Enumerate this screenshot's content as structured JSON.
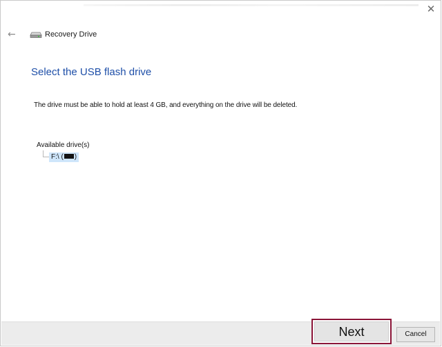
{
  "window": {
    "close_glyph": "✕",
    "back_glyph": "←"
  },
  "header": {
    "app_title": "Recovery Drive",
    "icon": "drive-icon"
  },
  "main": {
    "page_title": "Select the USB flash drive",
    "description": "The drive must be able to hold at least 4 GB, and everything on the drive will be deleted.",
    "drives_label": "Available drive(s)",
    "drives": [
      {
        "letter": "F:\\ (",
        "name": "(redacted)",
        "close": ")"
      }
    ]
  },
  "footer": {
    "next_label": "Next",
    "cancel_label": "Cancel"
  },
  "colors": {
    "title_blue": "#1e4fa8",
    "selection": "#cfe6fb",
    "highlight_border": "#8b1538",
    "footer_bg": "#ececec"
  }
}
